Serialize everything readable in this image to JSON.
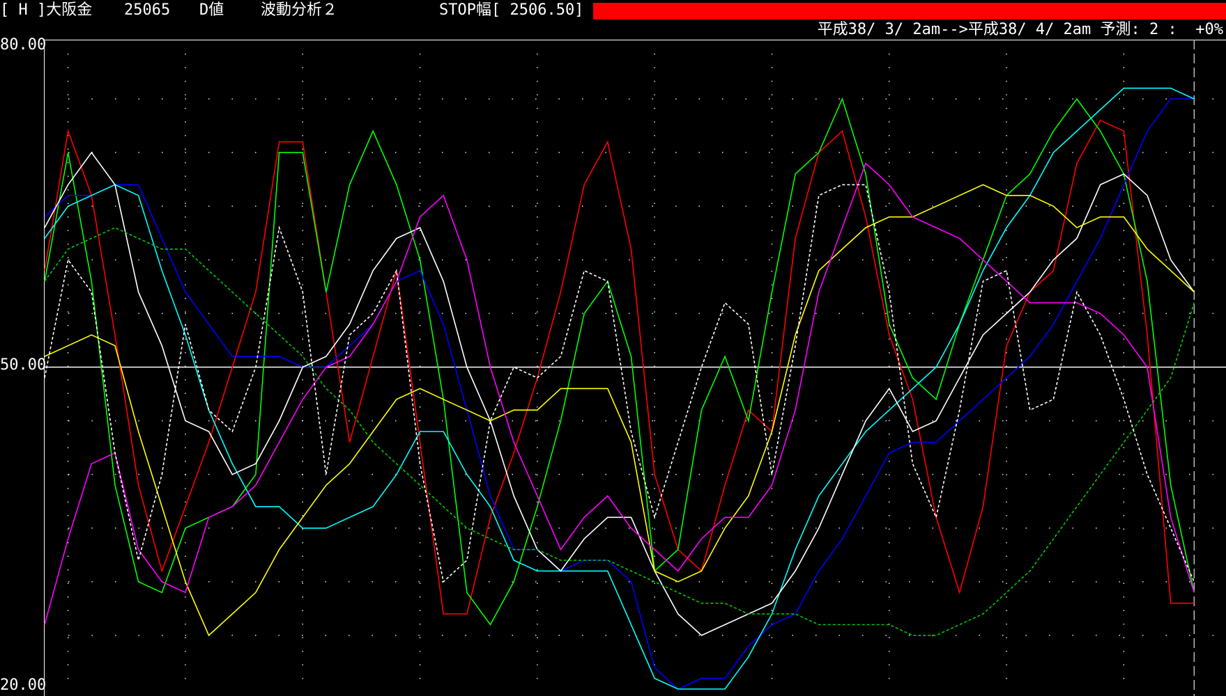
{
  "header": {
    "code": "[ H ]大阪金",
    "price": "25065",
    "mode": "D値",
    "analysis": "波動分析２",
    "stop_label": "STOP幅[ 2506.50]",
    "stop_bar_color": "#ff0000",
    "range_text": "平成38/ 3/ 2am-->平成38/ 4/ 2am 予測: 2 :  +0%"
  },
  "chart_data": {
    "type": "line",
    "ylim": [
      20,
      80
    ],
    "yticks": [
      "80.00",
      "50.00",
      "20.00"
    ],
    "midline": 50,
    "grid": "dotted",
    "x": [
      0,
      1,
      2,
      3,
      4,
      5,
      6,
      7,
      8,
      9,
      10,
      11,
      12,
      13,
      14,
      15,
      16,
      17,
      18,
      19,
      20,
      21,
      22,
      23,
      24,
      25,
      26,
      27,
      28,
      29,
      30,
      31,
      32,
      33,
      34,
      35,
      36,
      37,
      38,
      39,
      40,
      41,
      42,
      43,
      44,
      45,
      46,
      47,
      48,
      49,
      50
    ],
    "forecast_x": 49,
    "series": [
      {
        "color": "#ff0000",
        "style": "solid",
        "values": [
          59,
          72,
          66,
          53,
          39,
          31,
          37,
          43,
          50,
          57,
          71,
          71,
          57,
          43,
          51,
          59,
          43,
          27,
          27,
          36,
          42,
          49,
          57,
          67,
          71,
          61,
          40,
          33,
          31,
          39,
          46,
          44,
          62,
          70,
          72,
          64,
          53,
          47,
          36,
          29,
          37,
          52,
          57,
          59,
          69,
          73,
          72,
          53,
          28,
          28
        ]
      },
      {
        "color": "#00ff00",
        "style": "solid",
        "values": [
          58,
          70,
          58,
          39,
          30,
          29,
          35,
          36,
          37,
          40,
          70,
          70,
          57,
          67,
          72,
          67,
          60,
          47,
          29,
          26,
          30,
          37,
          45,
          55,
          58,
          51,
          31,
          33,
          46,
          51,
          45,
          57,
          68,
          70,
          75,
          68,
          54,
          49,
          47,
          54,
          60,
          66,
          68,
          72,
          75,
          72,
          68,
          58,
          39,
          29
        ]
      },
      {
        "color": "#0000ff",
        "style": "solid",
        "values": [
          64,
          66,
          66,
          67,
          67,
          62,
          57,
          54,
          51,
          51,
          51,
          50,
          50,
          52,
          54,
          58,
          59,
          54,
          46,
          38,
          33,
          33,
          31,
          32,
          32,
          30,
          22,
          20,
          21,
          21,
          24,
          26,
          27,
          31,
          34,
          38,
          42,
          43,
          43,
          45,
          47,
          49,
          51,
          54,
          58,
          62,
          67,
          72,
          75,
          75
        ]
      },
      {
        "color": "#00ffff",
        "style": "solid",
        "values": [
          62,
          65,
          66,
          67,
          66,
          59,
          53,
          46,
          41,
          37,
          37,
          35,
          35,
          36,
          37,
          40,
          44,
          44,
          40,
          37,
          32,
          31,
          31,
          31,
          31,
          26,
          21,
          20,
          20,
          20,
          23,
          27,
          33,
          38,
          41,
          44,
          46,
          48,
          50,
          54,
          59,
          63,
          66,
          70,
          72,
          74,
          76,
          76,
          76,
          75
        ]
      },
      {
        "color": "#ffffff",
        "style": "solid",
        "values": [
          63,
          67,
          70,
          67,
          57,
          52,
          45,
          44,
          40,
          41,
          45,
          50,
          51,
          54,
          59,
          62,
          63,
          58,
          50,
          45,
          38,
          33,
          31,
          34,
          36,
          36,
          31,
          27,
          25,
          26,
          27,
          28,
          31,
          35,
          40,
          45,
          48,
          44,
          45,
          49,
          53,
          55,
          57,
          60,
          62,
          67,
          68,
          66,
          60,
          57
        ]
      },
      {
        "color": "#ffff00",
        "style": "solid",
        "values": [
          51,
          52,
          53,
          52,
          44,
          37,
          30,
          25,
          27,
          29,
          33,
          36,
          39,
          41,
          44,
          47,
          48,
          47,
          46,
          45,
          46,
          46,
          48,
          48,
          48,
          43,
          31,
          30,
          31,
          35,
          38,
          44,
          53,
          59,
          61,
          63,
          64,
          64,
          65,
          66,
          67,
          66,
          66,
          65,
          63,
          64,
          64,
          61,
          59,
          57
        ]
      },
      {
        "color": "#ff00ff",
        "style": "solid",
        "values": [
          26,
          34,
          41,
          42,
          33,
          30,
          29,
          36,
          37,
          39,
          43,
          47,
          50,
          51,
          54,
          58,
          64,
          66,
          60,
          50,
          43,
          38,
          33,
          36,
          38,
          35,
          33,
          31,
          34,
          36,
          36,
          39,
          46,
          57,
          63,
          69,
          67,
          64,
          63,
          62,
          60,
          58,
          56,
          56,
          56,
          55,
          53,
          50,
          36,
          29
        ]
      },
      {
        "color": "#00cc00",
        "style": "dotted",
        "values": [
          58,
          61,
          62,
          63,
          62,
          61,
          61,
          59,
          57,
          55,
          53,
          51,
          48,
          46,
          43,
          41,
          39,
          37,
          35,
          34,
          33,
          33,
          32,
          32,
          32,
          31,
          30,
          29,
          28,
          28,
          27,
          27,
          27,
          26,
          26,
          26,
          26,
          25,
          25,
          26,
          27,
          29,
          31,
          34,
          37,
          40,
          43,
          46,
          49,
          56
        ]
      },
      {
        "color": "#ffffff",
        "style": "dotted",
        "values": [
          49,
          60,
          57,
          42,
          32,
          40,
          54,
          46,
          44,
          50,
          63,
          57,
          40,
          53,
          55,
          59,
          41,
          30,
          32,
          45,
          50,
          49,
          51,
          59,
          58,
          44,
          36,
          43,
          50,
          56,
          54,
          40,
          52,
          66,
          67,
          67,
          57,
          41,
          36,
          46,
          58,
          59,
          46,
          47,
          57,
          53,
          47,
          40,
          35,
          30
        ]
      }
    ]
  }
}
